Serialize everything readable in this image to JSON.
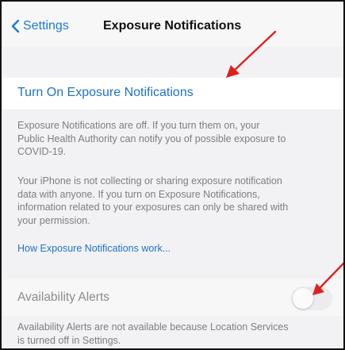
{
  "nav": {
    "back_label": "Settings",
    "title": "Exposure Notifications"
  },
  "turn_on_label": "Turn On Exposure Notifications",
  "paragraphs": [
    [
      "Exposure Notifications are off. If you turn them on, your",
      "Public Health Authority can notify you of possible exposure to",
      "COVID-19."
    ],
    [
      "Your iPhone is not collecting or sharing exposure notification",
      "data with anyone. If you turn on Exposure Notifications,",
      "information related to your exposures can only be shared with",
      "your permission."
    ]
  ],
  "how_link": "How Exposure Notifications work...",
  "availability": {
    "label": "Availability Alerts",
    "toggle_on": false,
    "note_lines": [
      "Availability Alerts are not available because Location Services",
      "is turned off in Settings."
    ]
  },
  "colors": {
    "link": "#1f73c7",
    "annotation_arrow": "#e02020"
  }
}
